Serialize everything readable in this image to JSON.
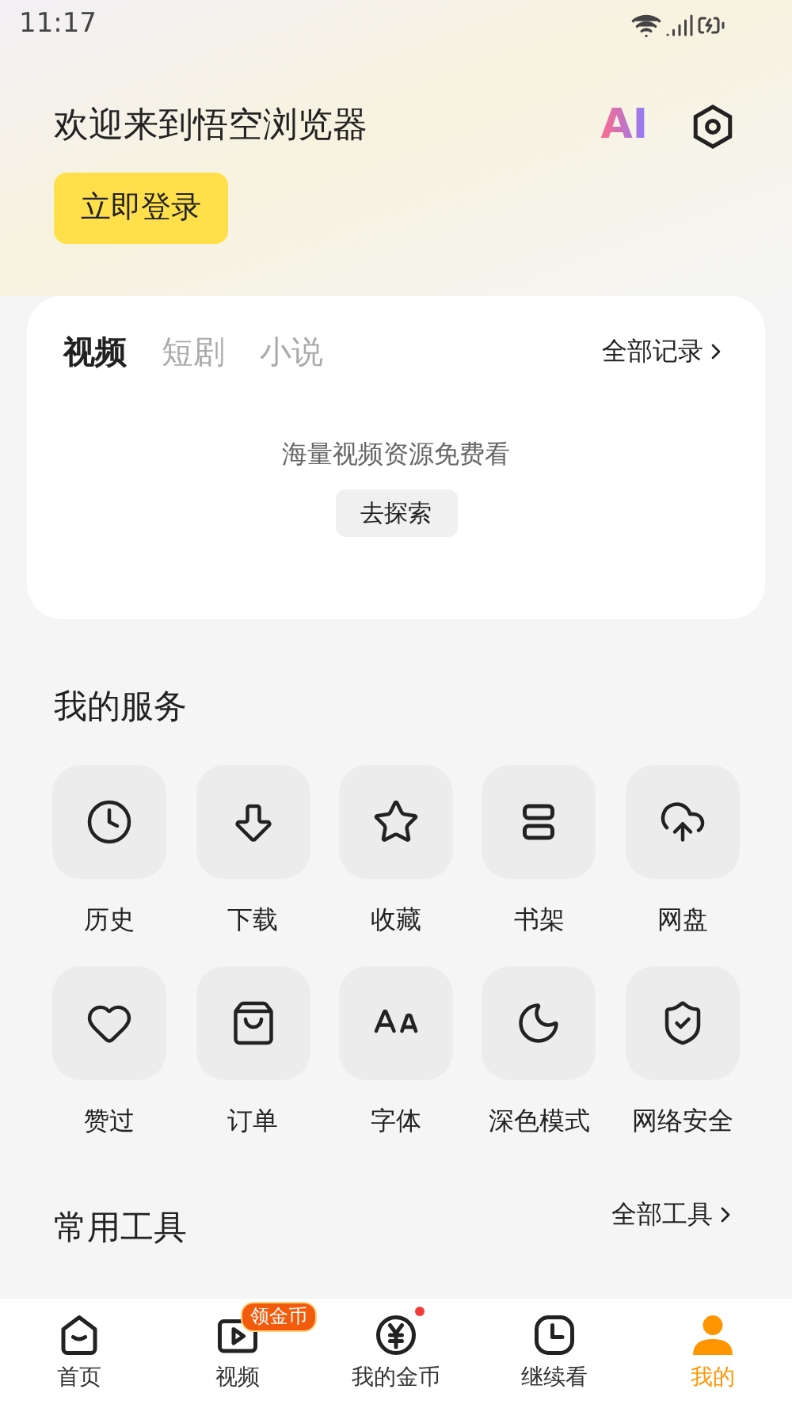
{
  "status_bar": {
    "time": "11:17"
  },
  "header": {
    "title": "欢迎来到悟空浏览器",
    "ai_label": "AI",
    "login_button": "立即登录"
  },
  "history_card": {
    "tabs": [
      {
        "label": "视频",
        "selected": true
      },
      {
        "label": "短剧",
        "selected": false
      },
      {
        "label": "小说",
        "selected": false
      }
    ],
    "all_records": "全部记录",
    "empty_text": "海量视频资源免费看",
    "explore_button": "去探索"
  },
  "services": {
    "title": "我的服务",
    "items": [
      {
        "label": "历史"
      },
      {
        "label": "下载"
      },
      {
        "label": "收藏"
      },
      {
        "label": "书架"
      },
      {
        "label": "网盘"
      },
      {
        "label": "赞过"
      },
      {
        "label": "订单"
      },
      {
        "label": "字体"
      },
      {
        "label": "深色模式"
      },
      {
        "label": "网络安全"
      }
    ]
  },
  "tools": {
    "title": "常用工具",
    "all_tools": "全部工具"
  },
  "bottom_nav": [
    {
      "label": "首页",
      "selected": false
    },
    {
      "label": "视频",
      "selected": false,
      "badge": "领金币"
    },
    {
      "label": "我的金币",
      "selected": false,
      "dot": true
    },
    {
      "label": "继续看",
      "selected": false
    },
    {
      "label": "我的",
      "selected": true
    }
  ]
}
